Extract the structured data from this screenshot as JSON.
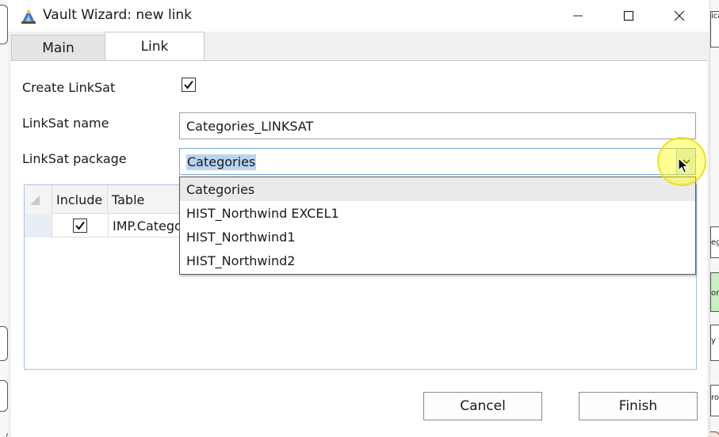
{
  "window": {
    "title": "Vault Wizard: new link"
  },
  "tabs": [
    {
      "label": "Main",
      "active": false
    },
    {
      "label": "Link",
      "active": true
    }
  ],
  "form": {
    "create_linksat_label": "Create LinkSat",
    "create_linksat_checked": true,
    "linksat_name_label": "LinkSat name",
    "linksat_name_value": "Categories_LINKSAT",
    "linksat_package_label": "LinkSat package",
    "linksat_package_value": "Categories"
  },
  "dropdown": {
    "options": [
      "Categories",
      "HIST_Northwind EXCEL1",
      "HIST_Northwind1",
      "HIST_Northwind2"
    ],
    "highlighted_index": 0
  },
  "grid": {
    "columns": [
      "Include",
      "Table"
    ],
    "rows": [
      {
        "include": true,
        "table": "IMP.Catego"
      }
    ]
  },
  "buttons": {
    "cancel": "Cancel",
    "finish": "Finish"
  },
  "background": {
    "snippets": [
      "ica",
      "eg",
      "on",
      "y S",
      "ro"
    ]
  },
  "colors": {
    "selection": "#b8d4f2",
    "focus_border": "#7aa7d8",
    "cursor_highlight": "#ffff00"
  }
}
